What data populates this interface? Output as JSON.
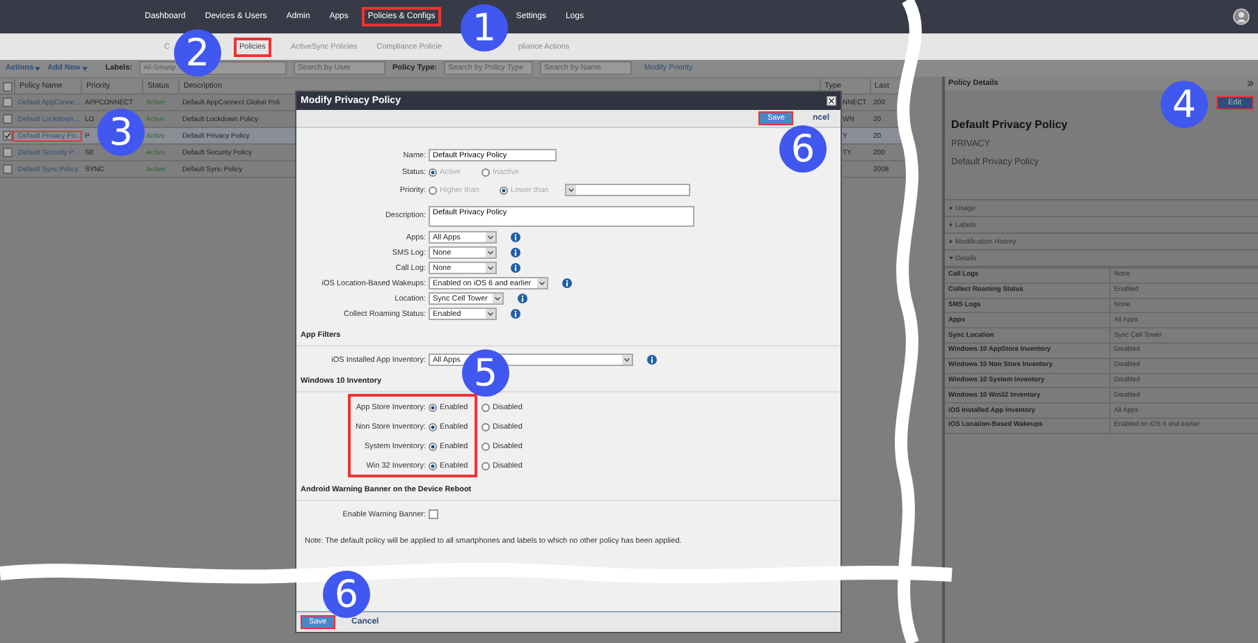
{
  "nav": {
    "items": [
      {
        "label": "Dashboard",
        "selected": false
      },
      {
        "label": "Devices & Users",
        "selected": false
      },
      {
        "label": "Admin",
        "selected": false
      },
      {
        "label": "Apps",
        "selected": false
      },
      {
        "label": "Policies & Configs",
        "selected": true
      },
      {
        "label": "Settings",
        "selected": false
      },
      {
        "label": "Logs",
        "selected": false
      }
    ]
  },
  "subtabs": [
    {
      "label": "C",
      "selected": false
    },
    {
      "label": "Policies",
      "selected": true
    },
    {
      "label": "ActiveSync Policies",
      "selected": false
    },
    {
      "label": "Compliance Policie",
      "selected": false
    },
    {
      "label": "pliance Actions",
      "selected": false
    }
  ],
  "toolbar": {
    "actions": "Actions",
    "add_new": "Add New",
    "labels_label": "Labels:",
    "labels_value": "All-Smartp",
    "user_search": {
      "placeholder": "Search by User"
    },
    "policy_type_label": "Policy Type:",
    "policy_type_placeholder": "Search by Policy Type",
    "name_search": {
      "placeholder": "Search by Name"
    },
    "modify_priority": "Modify Priority"
  },
  "table": {
    "all_checked": false,
    "columns": [
      "Policy Name",
      "Priority",
      "Status",
      "Description"
    ],
    "right_columns": [
      "Type",
      "Last"
    ],
    "rows": [
      {
        "name": "Default AppConne...",
        "priority": "APPCONNECT",
        "status": "Active",
        "description": "Default AppConnect Global Poli",
        "type": "NNECT",
        "last": "200",
        "selected": false
      },
      {
        "name": "Default Lockdown...",
        "priority": "LO",
        "status": "Active",
        "description": "Default Lockdown Policy",
        "type": "WN",
        "last": "20",
        "selected": false
      },
      {
        "name": "Default Privacy Po...",
        "priority": "P",
        "status": "Active",
        "description": "Default Privacy Policy",
        "type": "Y",
        "last": "20",
        "selected": true
      },
      {
        "name": "Default Security P...",
        "priority": "SE",
        "status": "Active",
        "description": "Default Security Policy",
        "type": "TY",
        "last": "200",
        "selected": false
      },
      {
        "name": "Default Sync Policy",
        "priority": "SYNC",
        "status": "Active",
        "description": "Default Sync Policy",
        "type": "",
        "last": "2008",
        "selected": false
      }
    ]
  },
  "modal": {
    "title": "Modify Privacy Policy",
    "save_top": "Save",
    "cancel_top": "ncel",
    "save_bottom": "Save",
    "cancel": "Cancel",
    "sections": [
      {
        "highlight": false,
        "fields": [
          {
            "kind": "text",
            "label": "Name:",
            "value": "Default Privacy Policy"
          },
          {
            "kind": "radio",
            "label": "Status:",
            "disabled": true,
            "options": [
              {
                "label": "Active",
                "selected": true
              },
              {
                "label": "Inactive",
                "selected": false
              }
            ]
          },
          {
            "kind": "priority",
            "label": "Priority:",
            "disabled": true,
            "options": [
              {
                "label": "Higher than",
                "selected": false
              },
              {
                "label": "Lower than",
                "selected": true
              }
            ]
          },
          {
            "kind": "textarea",
            "label": "Description:",
            "value": "Default Privacy Policy"
          },
          {
            "kind": "select",
            "label": "Apps:",
            "value": "All Apps"
          },
          {
            "kind": "select",
            "label": "SMS Log:",
            "value": "None"
          },
          {
            "kind": "select",
            "label": "Call Log:",
            "value": "None"
          },
          {
            "kind": "select",
            "label": "iOS Location-Based Wakeups:",
            "value": "Enabled on iOS 6 and earlier"
          },
          {
            "kind": "select",
            "label": "Location:",
            "value": "Sync Cell Tower"
          },
          {
            "kind": "select",
            "label": "Collect Roaming Status:",
            "value": "Enabled"
          }
        ]
      },
      {
        "heading": "App Filters",
        "highlight": false,
        "fields": [
          {
            "kind": "select",
            "label": "iOS Installed App Inventory:",
            "value": "All Apps"
          }
        ]
      },
      {
        "heading": "Windows 10 Inventory",
        "highlight": true,
        "fields": [
          {
            "kind": "radio",
            "label": "App Store Inventory:",
            "disabled": false,
            "options": [
              {
                "label": "Enabled",
                "selected": true
              },
              {
                "label": "Disabled",
                "selected": false
              }
            ]
          },
          {
            "kind": "radio",
            "label": "Non Store Inventory:",
            "disabled": false,
            "options": [
              {
                "label": "Enabled",
                "selected": true
              },
              {
                "label": "Disabled",
                "selected": false
              }
            ]
          },
          {
            "kind": "radio",
            "label": "System Inventory:",
            "disabled": false,
            "options": [
              {
                "label": "Enabled",
                "selected": true
              },
              {
                "label": "Disabled",
                "selected": false
              }
            ]
          },
          {
            "kind": "radio",
            "label": "Win 32 Inventory:",
            "disabled": false,
            "options": [
              {
                "label": "Enabled",
                "selected": true
              },
              {
                "label": "Disabled",
                "selected": false
              }
            ]
          }
        ]
      },
      {
        "heading": "Android Warning Banner on the Device Reboot",
        "highlight": false,
        "fields": [
          {
            "kind": "checkbox",
            "label": "Enable Warning Banner:",
            "checked": false
          }
        ]
      }
    ],
    "note": "Note: The default policy will be applied to all smartphones and labels to which no other policy has been applied."
  },
  "details": {
    "header": "Policy Details",
    "edit": "Edit",
    "title": "Default Privacy Policy",
    "type": "PRIVACY",
    "description": "Default Privacy Policy",
    "sections": [
      {
        "label": "Usage",
        "expanded": false
      },
      {
        "label": "Labels",
        "expanded": false
      },
      {
        "label": "Modification History",
        "expanded": false
      },
      {
        "label": "Details",
        "expanded": true
      }
    ],
    "rows": [
      {
        "label": "Call Logs",
        "value": "None"
      },
      {
        "label": "Collect Roaming Status",
        "value": "Enabled"
      },
      {
        "label": "SMS Logs",
        "value": "None"
      },
      {
        "label": "Apps",
        "value": "All Apps"
      },
      {
        "label": "Sync Location",
        "value": "Sync Cell Tower"
      },
      {
        "label": "Windows 10 AppStore Inventory",
        "value": "Disabled"
      },
      {
        "label": "Windows 10 Non Store Inventory",
        "value": "Disabled"
      },
      {
        "label": "Windows 10 System Inventory",
        "value": "Disabled"
      },
      {
        "label": "Windows 10 Win32 Inventory",
        "value": "Disabled"
      },
      {
        "label": "iOS Installed App Inventory",
        "value": "All Apps"
      },
      {
        "label": "iOS Location-Based Wakeups",
        "value": "Enabled on iOS 6 and earlier"
      }
    ]
  },
  "callouts": [
    "1",
    "2",
    "3",
    "4",
    "5",
    "6",
    "6"
  ]
}
